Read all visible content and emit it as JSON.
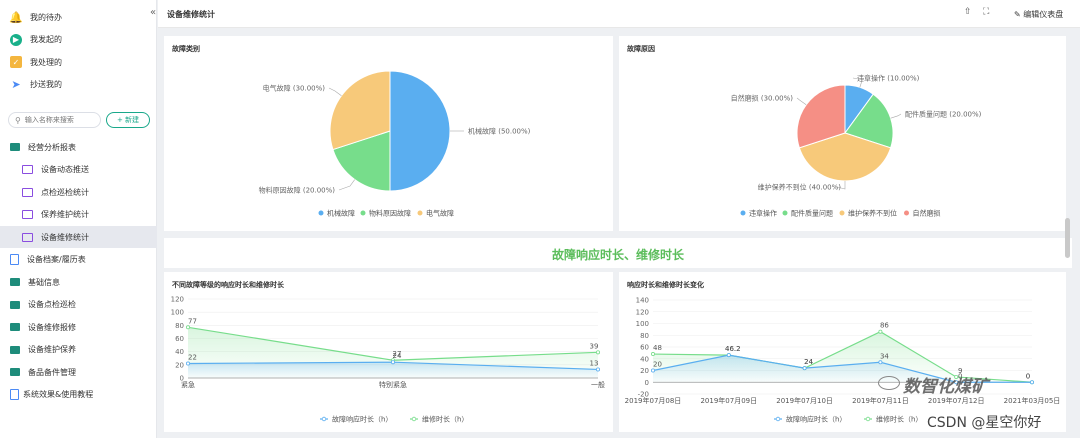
{
  "sidebar": {
    "top_items": [
      {
        "label": "我的待办",
        "icon": "bell-icon"
      },
      {
        "label": "我发起的",
        "icon": "play-icon"
      },
      {
        "label": "我处理的",
        "icon": "check-icon"
      },
      {
        "label": "抄送我的",
        "icon": "send-icon"
      }
    ],
    "search_placeholder": "输入名称来搜索",
    "new_label": "+ 新建",
    "tree": [
      {
        "label": "经营分析报表",
        "icon": "folder-icon",
        "sub": false
      },
      {
        "label": "设备动态推送",
        "icon": "chart-icon",
        "sub": true
      },
      {
        "label": "点检巡检统计",
        "icon": "chart-icon",
        "sub": true
      },
      {
        "label": "保养维护统计",
        "icon": "chart-icon",
        "sub": true
      },
      {
        "label": "设备维修统计",
        "icon": "chart-icon",
        "sub": true,
        "active": true
      },
      {
        "label": "设备档案/履历表",
        "icon": "doc-icon",
        "sub": false
      },
      {
        "label": "基础信息",
        "icon": "folder-icon",
        "sub": false
      },
      {
        "label": "设备点检巡检",
        "icon": "folder-icon",
        "sub": false
      },
      {
        "label": "设备维修报修",
        "icon": "folder-icon",
        "sub": false
      },
      {
        "label": "设备维护保养",
        "icon": "folder-icon",
        "sub": false
      },
      {
        "label": "备品备件管理",
        "icon": "folder-icon",
        "sub": false
      },
      {
        "label": "系统效果&使用教程",
        "icon": "doc-icon",
        "sub": false
      }
    ]
  },
  "header": {
    "title": "设备维修统计",
    "edit_label": "编辑仪表盘"
  },
  "banner": {
    "text": "故障响应时长、维修时长"
  },
  "chart_data": [
    {
      "type": "pie",
      "title": "故障类别",
      "labels": [
        "机械故障",
        "物料原因故障",
        "电气故障"
      ],
      "values": [
        50.0,
        20.0,
        30.0
      ],
      "slice_labels": [
        "机械故障 (50.00%)",
        "物料原因故障 (20.00%)",
        "电气故障 (30.00%)"
      ],
      "colors": [
        "#5aaef0",
        "#77dd8b",
        "#f7c97a"
      ],
      "legend": "bottom"
    },
    {
      "type": "pie",
      "title": "故障原因",
      "labels": [
        "违章操作",
        "配件质量问题",
        "维护保养不到位",
        "自然磨损"
      ],
      "values": [
        10.0,
        20.0,
        40.0,
        30.0
      ],
      "slice_labels": [
        "违章操作 (10.00%)",
        "配件质量问题 (20.00%)",
        "维护保养不到位 (40.00%)",
        "自然磨损 (30.00%)"
      ],
      "colors": [
        "#5aaef0",
        "#77dd8b",
        "#f7c97a",
        "#f58f85"
      ],
      "legend": "bottom"
    },
    {
      "type": "area",
      "title": "不同故障等级的响应时长和维修时长",
      "categories": [
        "紧急",
        "特别紧急",
        "一般"
      ],
      "series": [
        {
          "name": "故障响应时长（h）",
          "values": [
            22,
            24,
            13
          ],
          "color": "#5aaef0"
        },
        {
          "name": "维修时长（h）",
          "values": [
            77,
            27,
            39
          ],
          "color": "#77dd8b"
        }
      ],
      "ylim": [
        0,
        120
      ],
      "yticks": [
        0,
        20,
        40,
        60,
        80,
        100,
        120
      ],
      "legend": "bottom"
    },
    {
      "type": "area",
      "title": "响应时长和维修时长变化",
      "categories": [
        "2019年07月08日",
        "2019年07月09日",
        "2019年07月10日",
        "2019年07月11日",
        "2019年07月12日",
        "2021年03月05日"
      ],
      "series": [
        {
          "name": "故障响应时长（h）",
          "values": [
            20,
            46.2,
            24,
            34,
            0,
            0
          ],
          "color": "#5aaef0"
        },
        {
          "name": "维修时长（h）",
          "values": [
            48,
            46.2,
            24,
            86,
            9,
            0
          ],
          "color": "#77dd8b"
        }
      ],
      "ylim": [
        -20,
        140
      ],
      "yticks": [
        -20,
        0,
        20,
        40,
        60,
        80,
        100,
        120,
        140
      ],
      "legend": "bottom"
    }
  ],
  "watermark": {
    "line1": "数智化煤矿",
    "line2": "CSDN @星空你好"
  }
}
